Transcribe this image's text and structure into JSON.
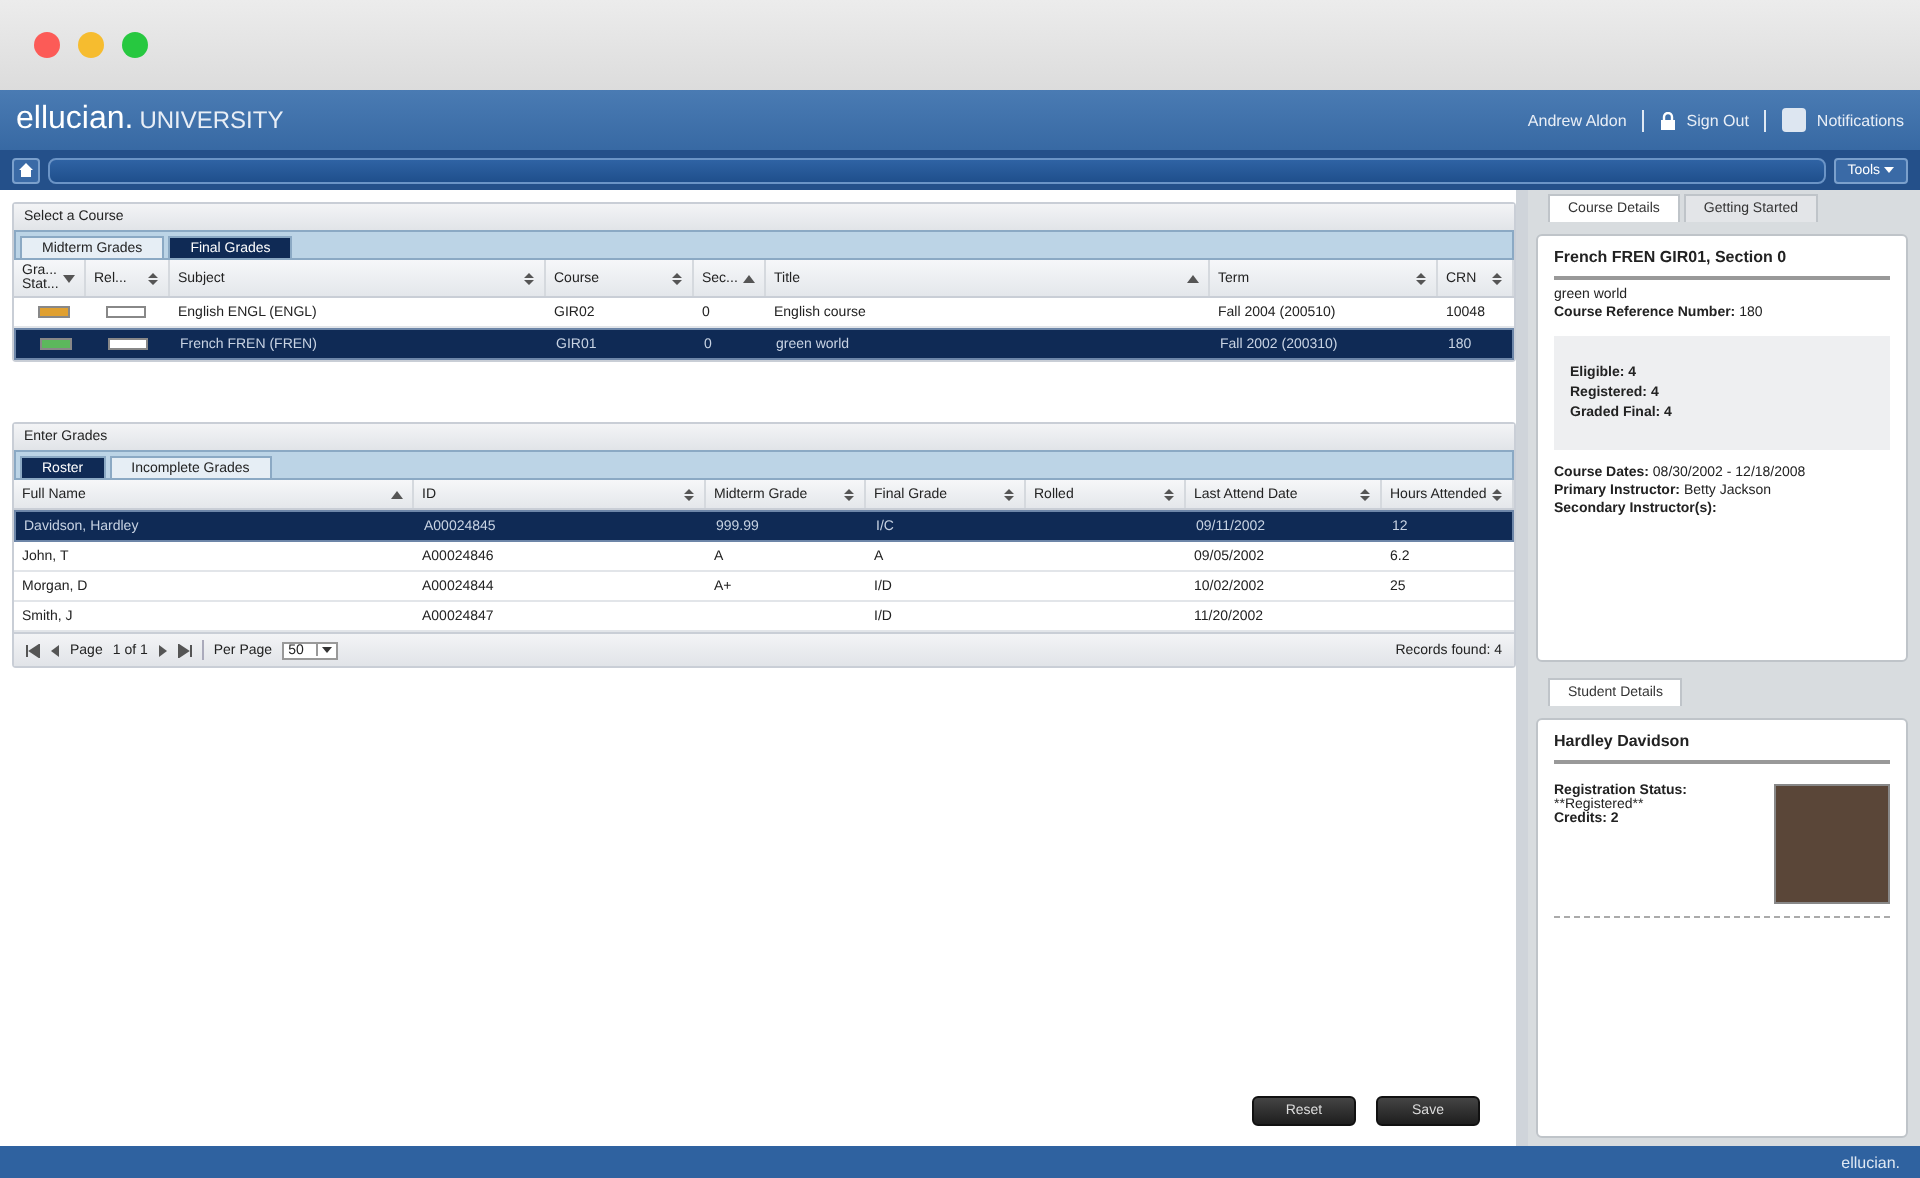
{
  "header": {
    "brand": "ellucian.",
    "brand_suffix": "UNIVERSITY",
    "user": "Andrew Aldon",
    "sign_out": "Sign Out",
    "notifications": "Notifications",
    "tools": "Tools"
  },
  "select_course": {
    "title": "Select a Course",
    "tabs": [
      {
        "label": "Midterm Grades",
        "selected": false
      },
      {
        "label": "Final Grades",
        "selected": true
      }
    ],
    "columns": [
      {
        "label": "Gra... Stat...",
        "kind": "descending"
      },
      {
        "label": "Rel...",
        "kind": "unsorted"
      },
      {
        "label": "Subject",
        "kind": "unsorted"
      },
      {
        "label": "Course",
        "kind": "unsorted"
      },
      {
        "label": "Sec...",
        "kind": "ascending"
      },
      {
        "label": "Title",
        "kind": "ascending"
      },
      {
        "label": "Term",
        "kind": "unsorted"
      },
      {
        "label": "CRN",
        "kind": "unsorted"
      }
    ],
    "rows": [
      {
        "selected": false,
        "color": "#e0a030",
        "cells": [
          "",
          "",
          "English ENGL (ENGL)",
          "GIR02",
          "0",
          "English course",
          "Fall 2004 (200510)",
          "10048"
        ]
      },
      {
        "selected": true,
        "color": "#5cb85c",
        "cells": [
          "",
          "",
          "French FREN (FREN)",
          "GIR01",
          "0",
          "green world",
          "Fall 2002 (200310)",
          "180"
        ]
      }
    ]
  },
  "enter_grades": {
    "title": "Enter Grades",
    "tabs": [
      {
        "label": "Roster",
        "selected": true
      },
      {
        "label": "Incomplete Grades",
        "selected": false
      }
    ],
    "columns": [
      {
        "label": "Full Name",
        "kind": "ascending"
      },
      {
        "label": "ID",
        "kind": "unsorted"
      },
      {
        "label": "Midterm Grade",
        "kind": "unsorted"
      },
      {
        "label": "Final Grade",
        "kind": "unsorted"
      },
      {
        "label": "Rolled",
        "kind": "unsorted"
      },
      {
        "label": "Last Attend Date",
        "kind": "unsorted"
      },
      {
        "label": "Hours Attended",
        "kind": "unsorted"
      }
    ],
    "rows": [
      {
        "selected": true,
        "cells": [
          "Davidson, Hardley",
          "A00024845",
          "999.99",
          "I/C",
          "",
          "09/11/2002",
          "12"
        ]
      },
      {
        "selected": false,
        "cells": [
          "John, T",
          "A00024846",
          "A",
          "A",
          "",
          "09/05/2002",
          "6.2"
        ]
      },
      {
        "selected": false,
        "cells": [
          "Morgan, D",
          "A00024844",
          "A+",
          "I/D",
          "",
          "10/02/2002",
          "25"
        ]
      },
      {
        "selected": false,
        "cells": [
          "Smith, J",
          "A00024847",
          "",
          "I/D",
          "",
          "11/20/2002",
          ""
        ]
      }
    ],
    "pager": {
      "page_label": "Page",
      "page_value": "1 of 1",
      "per_page_label": "Per Page",
      "per_page": "50",
      "records": "Records found: 4"
    }
  },
  "buttons": [
    "Reset",
    "Save"
  ],
  "course_details": {
    "tabs": [
      {
        "label": "Course Details",
        "selected": true
      },
      {
        "label": "Getting Started",
        "selected": false
      }
    ],
    "heading": "French FREN GIR01, Section 0",
    "subtitle": "green world",
    "crn": "**Course Reference Number:** 180",
    "stats": [
      "Eligible: 4",
      "Registered: 4",
      "Graded Final: 4"
    ],
    "lines": [
      "**Course Dates:** 08/30/2002 - 12/18/2008",
      "**Primary Instructor:** Betty Jackson",
      "**Secondary Instructor(s):**"
    ]
  },
  "student_details": {
    "tab": "Student Details",
    "name": "Hardley Davidson",
    "lines": [
      "Registration Status:",
      "**Registered**",
      "Credits: 2"
    ]
  },
  "footer": {
    "brand": "ellucian."
  }
}
